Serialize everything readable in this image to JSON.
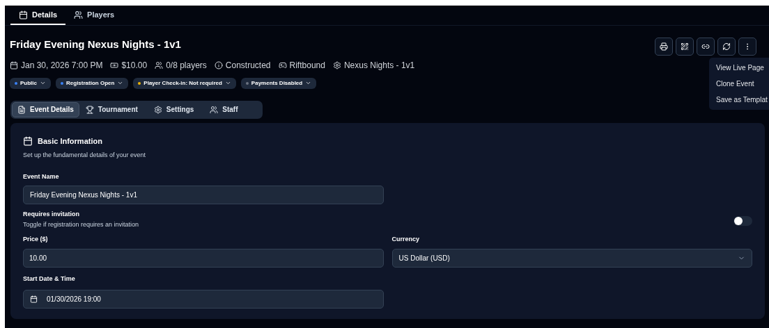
{
  "top_tabs": [
    {
      "label": "Details",
      "kind": "calendar",
      "selected": true
    },
    {
      "label": "Players",
      "kind": "users",
      "selected": false
    }
  ],
  "event": {
    "title": "Friday Evening Nexus Nights - 1v1",
    "meta": [
      {
        "kind": "calendar",
        "text": "Jan 30, 2026 7:00 PM"
      },
      {
        "kind": "money",
        "text": "$10.00"
      },
      {
        "kind": "users",
        "text": "0/8 players"
      },
      {
        "kind": "info",
        "text": "Constructed"
      },
      {
        "kind": "gamepad",
        "text": "Riftbound"
      },
      {
        "kind": "gear",
        "text": "Nexus Nights - 1v1"
      }
    ],
    "badges": [
      {
        "label": "Public",
        "color": "#3b82f6"
      },
      {
        "label": "Registration Open",
        "color": "#3b82f6"
      },
      {
        "label": "Player Check-in: Not required",
        "color": "#eab308"
      },
      {
        "label": "Payments Disabled",
        "color": "#6b7280"
      }
    ]
  },
  "toolbar": [
    {
      "kind": "printer"
    },
    {
      "kind": "qr"
    },
    {
      "kind": "link"
    },
    {
      "kind": "refresh"
    },
    {
      "kind": "more"
    }
  ],
  "menu": {
    "items": [
      "View Live Page",
      "Clone Event",
      "Save as Templat"
    ]
  },
  "section_tabs": [
    {
      "label": "Event Details",
      "kind": "file",
      "selected": true
    },
    {
      "label": "Tournament",
      "kind": "trophy",
      "selected": false
    },
    {
      "label": "Settings",
      "kind": "gear",
      "selected": false
    },
    {
      "label": "Staff",
      "kind": "users",
      "selected": false
    }
  ],
  "card": {
    "title": "Basic Information",
    "subtitle": "Set up the fundamental details of your event",
    "event_name": {
      "label": "Event Name",
      "value": "Friday Evening Nexus Nights - 1v1"
    },
    "requires_invitation": {
      "label": "Requires invitation",
      "hint": "Toggle if registration requires an invitation",
      "on": false
    },
    "price": {
      "label": "Price ($)",
      "value": "10.00"
    },
    "currency": {
      "label": "Currency",
      "value": "US Dollar (USD)"
    },
    "start": {
      "label": "Start Date & Time",
      "value": "01/30/2026 19:00"
    }
  }
}
